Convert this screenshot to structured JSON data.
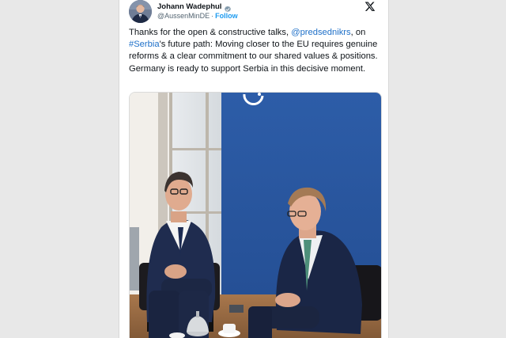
{
  "author": {
    "name": "Johann Wadephul",
    "handle": "@AussenMinDE",
    "separator": "·",
    "follow_label": "Follow"
  },
  "icons": {
    "verified": "verified-badge-icon",
    "brand": "x-logo-icon"
  },
  "tweet": {
    "text_part1": "Thanks for the open & constructive talks, ",
    "mention": "@predsednikrs",
    "text_part2": ", on ",
    "hashtag": "#Serbia",
    "text_part3": "'s future path: Moving closer to the EU requires genuine reforms & a clear commitment to our shared values & positions. Germany is ready to support Serbia in this decisive moment."
  },
  "colors": {
    "link": "#1d6fc8",
    "verified": "#829aab",
    "backdrop": "#2f5fa6"
  }
}
